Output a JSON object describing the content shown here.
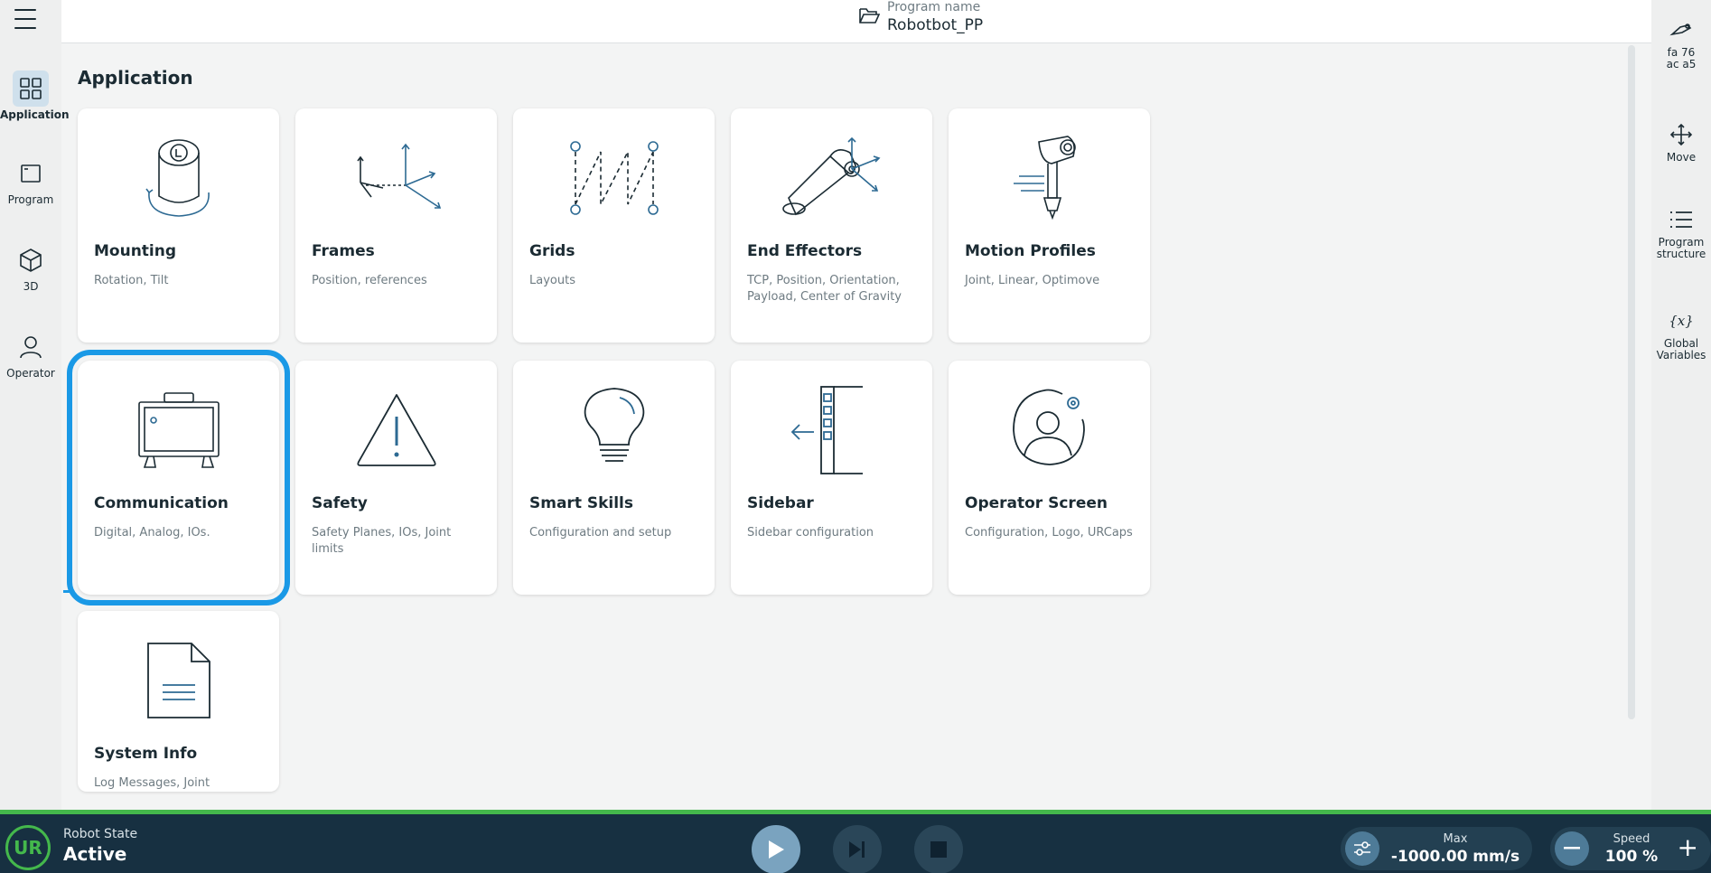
{
  "header": {
    "program_label": "Program name",
    "program_name": "Robotbot_PP"
  },
  "left_nav": [
    {
      "label": "Application",
      "icon": "grid-icon",
      "active": true
    },
    {
      "label": "Program",
      "icon": "program-window-icon",
      "active": false
    },
    {
      "label": "3D",
      "icon": "cube-icon",
      "active": false
    },
    {
      "label": "Operator",
      "icon": "person-icon",
      "active": false
    }
  ],
  "right_nav": {
    "id_line1": "fa 76",
    "id_line2": "ac a5",
    "move": "Move",
    "program_structure": "Program structure",
    "global_variables": "Global Variables"
  },
  "main": {
    "title": "Application"
  },
  "cards": [
    {
      "title": "Mounting",
      "subtitle": "Rotation, Tilt"
    },
    {
      "title": "Frames",
      "subtitle": "Position, references"
    },
    {
      "title": "Grids",
      "subtitle": "Layouts"
    },
    {
      "title": "End Effectors",
      "subtitle": "TCP, Position, Orientation, Payload, Center of Gravity"
    },
    {
      "title": "Motion Profiles",
      "subtitle": "Joint, Linear, Optimove"
    },
    {
      "title": "Communication",
      "subtitle": "Digital, Analog, IOs."
    },
    {
      "title": "Safety",
      "subtitle": "Safety Planes, IOs, Joint limits"
    },
    {
      "title": "Smart Skills",
      "subtitle": "Configuration and setup"
    },
    {
      "title": "Sidebar",
      "subtitle": "Sidebar configuration"
    },
    {
      "title": "Operator Screen",
      "subtitle": "Configuration, Logo, URCaps"
    },
    {
      "title": "System Info",
      "subtitle": "Log Messages, Joint"
    }
  ],
  "bottom": {
    "logo_text": "UR",
    "robot_state_label": "Robot State",
    "robot_state_value": "Active",
    "max_label": "Max",
    "max_value": "-1000.00 mm/s",
    "speed_label": "Speed",
    "speed_value": "100 %",
    "speed_plus": "+"
  },
  "colors": {
    "accent": "#1a99e6",
    "status_green": "#44b84c",
    "bottom_bar": "#173041"
  }
}
